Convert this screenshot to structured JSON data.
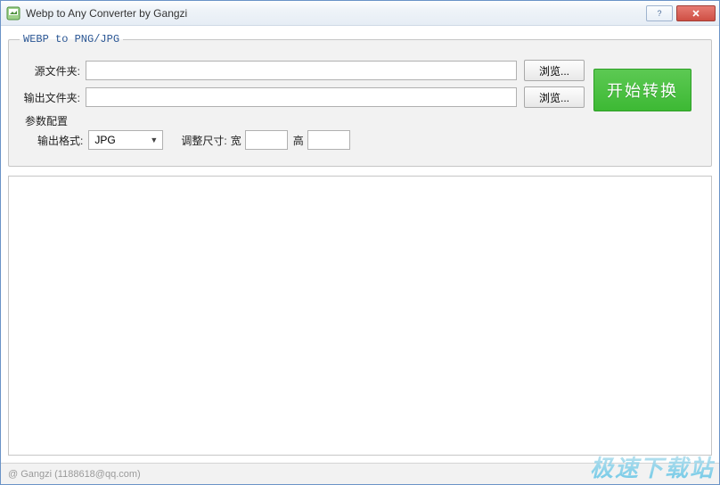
{
  "window": {
    "title": "Webp to Any Converter by Gangzi"
  },
  "group": {
    "legend": "WEBP to PNG/JPG",
    "source": {
      "label": "源文件夹:",
      "value": "",
      "browse": "浏览..."
    },
    "output": {
      "label": "输出文件夹:",
      "value": "",
      "browse": "浏览..."
    },
    "start_button": "开始转换",
    "params": {
      "heading": "参数配置",
      "format_label": "输出格式:",
      "format_value": "JPG",
      "resize_label": "调整尺寸:",
      "width_label": "宽",
      "width_value": "",
      "height_label": "高",
      "height_value": ""
    }
  },
  "statusbar": {
    "text": "@ Gangzi (1188618@qq.com)"
  },
  "watermark": "极速下载站"
}
